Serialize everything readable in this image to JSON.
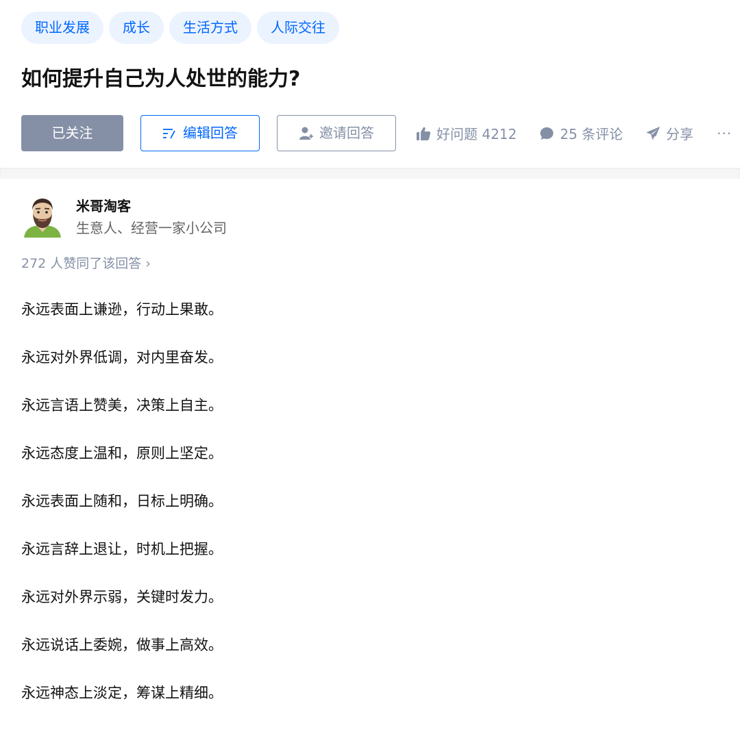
{
  "tags": [
    "职业发展",
    "成长",
    "生活方式",
    "人际交往"
  ],
  "question": {
    "title": "如何提升自己为人处世的能力?"
  },
  "actions": {
    "follow_label": "已关注",
    "edit_label": "编辑回答",
    "invite_label": "邀请回答",
    "good_question_label": "好问题 4212",
    "comments_label": "25 条评论",
    "share_label": "分享",
    "more_label": "···"
  },
  "answer": {
    "author_name": "米哥淘客",
    "author_bio": "生意人、经营一家小公司",
    "votes_text": "272 人赞同了该回答 ›",
    "paragraphs": [
      "永远表面上谦逊，行动上果敢。",
      "永远对外界低调，对内里奋发。",
      "永远言语上赞美，决策上自主。",
      "永远态度上温和，原则上坚定。",
      "永远表面上随和，日标上明确。",
      "永远言辞上退让，时机上把握。",
      "永远对外界示弱，关键时发力。",
      "永远说话上委婉，做事上高效。",
      "永远神态上淡定，筹谋上精细。"
    ]
  },
  "icons": {
    "edit": "edit-icon",
    "invite": "add-user-icon",
    "like": "thumbs-up-icon",
    "comment": "comment-bubble-icon",
    "share": "paper-plane-icon"
  },
  "colors": {
    "brand": "#0066ff",
    "tag_bg": "#ebf3ff",
    "muted": "#8590a6",
    "text": "#121212"
  }
}
